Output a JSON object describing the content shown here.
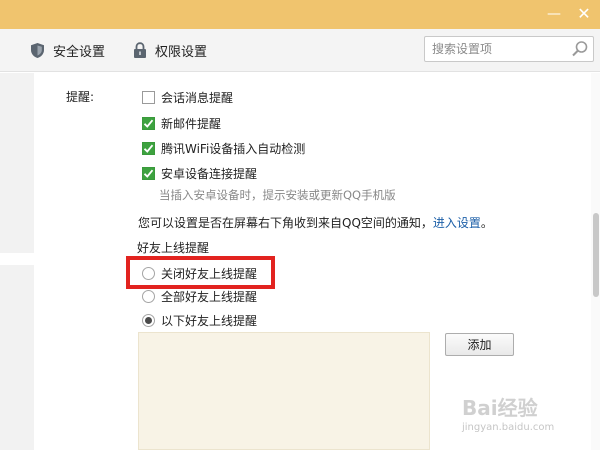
{
  "window": {
    "minimize_glyph": "—",
    "close_glyph": "✕"
  },
  "nav": {
    "security_label": "安全设置",
    "permission_label": "权限设置",
    "security_icon": "shield-icon",
    "permission_icon": "lock-icon"
  },
  "search": {
    "value": "",
    "placeholder": "搜索设置项",
    "icon": "search-icon"
  },
  "reminders": {
    "label": "提醒:",
    "options": [
      {
        "label": "会话消息提醒",
        "checked": false
      },
      {
        "label": "新邮件提醒",
        "checked": true
      },
      {
        "label": "腾讯WiFi设备插入自动检测",
        "checked": true
      },
      {
        "label": "安卓设备连接提醒",
        "checked": true
      }
    ],
    "android_hint": "当插入安卓设备时，提示安装或更新QQ手机版"
  },
  "notice": {
    "text": "您可以设置是否在屏幕右下角收到来自QQ空间的通知，",
    "link_label": "进入设置",
    "suffix": "。"
  },
  "friend_online": {
    "title": "好友上线提醒",
    "options": [
      {
        "label": "关闭好友上线提醒",
        "selected": false
      },
      {
        "label": "全部好友上线提醒",
        "selected": false
      },
      {
        "label": "以下好友上线提醒",
        "selected": true
      }
    ],
    "add_button_label": "添加"
  },
  "watermark": {
    "logo": "Bai经验",
    "url": "jingyan.baidu.com"
  },
  "colors": {
    "titlebar": "#f0c46e",
    "check_green": "#3da23f",
    "link_blue": "#1c5fa8",
    "highlight_red": "#e2231f",
    "friend_list_bg": "#f8f3e6"
  }
}
